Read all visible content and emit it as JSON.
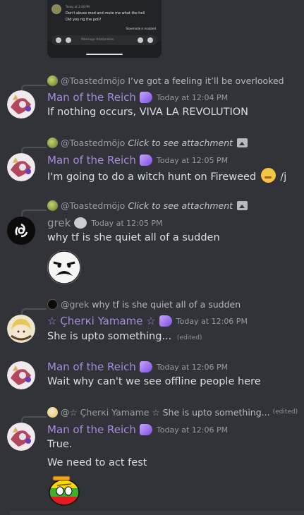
{
  "embed_image": {
    "header": "Today at 2:46 PM",
    "line1": "Don't abuse mod and mute me what the hell",
    "line2": "Did you rig the poll?",
    "slowmode": "Slowmode is enabled",
    "placeholder": "Message #detention"
  },
  "messages": [
    {
      "reply": {
        "user": "@Toastedmöjo",
        "text": "I’ve got a feeling it’ll be overlooked"
      },
      "author": "Man of the Reich",
      "time": "Today at 12:04 PM",
      "content": "If nothing occurs, VIVA LA REVOLUTION"
    },
    {
      "reply": {
        "user": "@Toastedmöjo",
        "text": "Click to see attachment"
      },
      "author": "Man of the Reich",
      "time": "Today at 12:05 PM",
      "content_before": "I'm going to do a witch hunt on Fireweed",
      "content_after": "/j"
    },
    {
      "reply": {
        "user": "@Toastedmöjo",
        "text": "Click to see attachment"
      },
      "author": "grek",
      "time": "Today at 12:05 PM",
      "content": "why tf is she quiet all of a sudden"
    },
    {
      "reply": {
        "user": "@grek",
        "text": "why tf is she quiet all of a sudden"
      },
      "author": "☆ Çherкі Yamame ☆",
      "time": "Today at 12:06 PM",
      "content": "She is upto something...",
      "edited": "(edited)"
    },
    {
      "author": "Man of the Reich",
      "time": "Today at 12:06 PM",
      "content": "Wait why can't we see offline people here"
    },
    {
      "reply": {
        "user": "@☆ Çherкі Yamame ☆",
        "text": "She is upto something...",
        "edited": "(edited)"
      },
      "author": "Man of the Reich",
      "time": "Today at 12:06 PM",
      "content": "True.",
      "content2": "We need to act fest"
    }
  ]
}
